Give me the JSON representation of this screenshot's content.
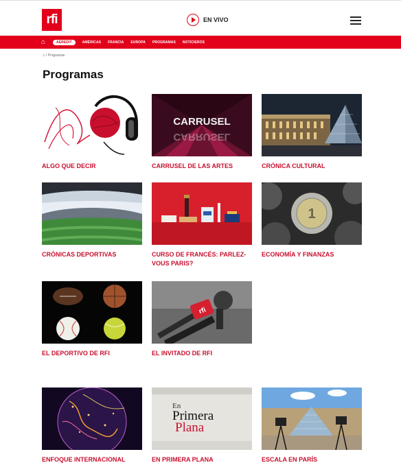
{
  "header": {
    "logo_text": "rfi",
    "live_label": "EN VIVO"
  },
  "nav": {
    "items": [
      "AEREDIT",
      "AMÉRICAS",
      "FRANCIA",
      "EUROPA",
      "PROGRAMAS",
      "NOTICIEROS"
    ]
  },
  "breadcrumb": "/ Programas",
  "page_title": "Programas",
  "programs": [
    {
      "label": "ALGO QUE DECIR"
    },
    {
      "label": "CARRUSEL DE LAS ARTES",
      "thumb_text": "CARRUSEL"
    },
    {
      "label": "CRÓNICA CULTURAL"
    },
    {
      "label": "CRÓNICAS DEPORTIVAS"
    },
    {
      "label": "CURSO DE FRANCÉS: PARLEZ-VOUS PARIS?"
    },
    {
      "label": "ECONOMÍA Y FINANZAS"
    },
    {
      "label": "EL DEPORTIVO DE RFI"
    },
    {
      "label": "EL INVITADO DE RFI"
    },
    {
      "label": "ENFOQUE INTERNACIONAL"
    },
    {
      "label": "EN PRIMERA PLANA",
      "thumb_text_1": "En",
      "thumb_text_2": "Primera",
      "thumb_text_3": "Plana"
    },
    {
      "label": "ESCALA EN PARÍS"
    }
  ],
  "colors": {
    "brand_red": "#e2001a",
    "label_red": "#c8102e"
  }
}
